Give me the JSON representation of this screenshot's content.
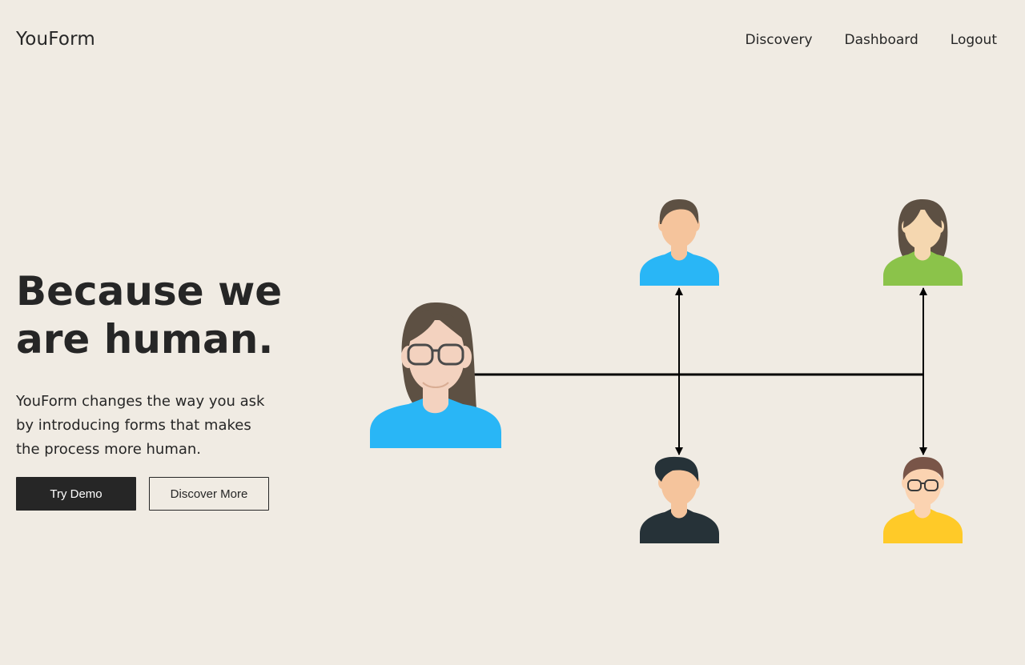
{
  "header": {
    "logo": "YouForm",
    "nav": [
      {
        "label": "Discovery"
      },
      {
        "label": "Dashboard"
      },
      {
        "label": "Logout"
      }
    ]
  },
  "hero": {
    "title_line1": "Because we",
    "title_line2": "are human.",
    "subtitle_line1": "YouForm changes the way you ask",
    "subtitle_line2": "by introducing forms that makes",
    "subtitle_line3": "the process more human.",
    "primary_button": "Try Demo",
    "secondary_button": "Discover More"
  },
  "illustration": {
    "people": [
      {
        "role": "central-woman",
        "shirt": "#29b6f6",
        "hair": "#5d5043",
        "glasses": true
      },
      {
        "role": "man-top-left",
        "shirt": "#29b6f6",
        "hair": "#5d5043",
        "glasses": false
      },
      {
        "role": "woman-top-right",
        "shirt": "#8bc34a",
        "hair": "#5d5043",
        "glasses": false
      },
      {
        "role": "man-bottom-left",
        "shirt": "#263238",
        "hair": "#263238",
        "glasses": false
      },
      {
        "role": "man-bottom-right",
        "shirt": "#ffca28",
        "hair": "#795548",
        "glasses": true
      }
    ],
    "icons": [
      "person-icon",
      "arrow-up-icon",
      "arrow-down-icon"
    ]
  },
  "colors": {
    "background": "#f0ebe3",
    "text": "#262626",
    "primary_button_bg": "#262626",
    "skin": "#f5cba7"
  }
}
